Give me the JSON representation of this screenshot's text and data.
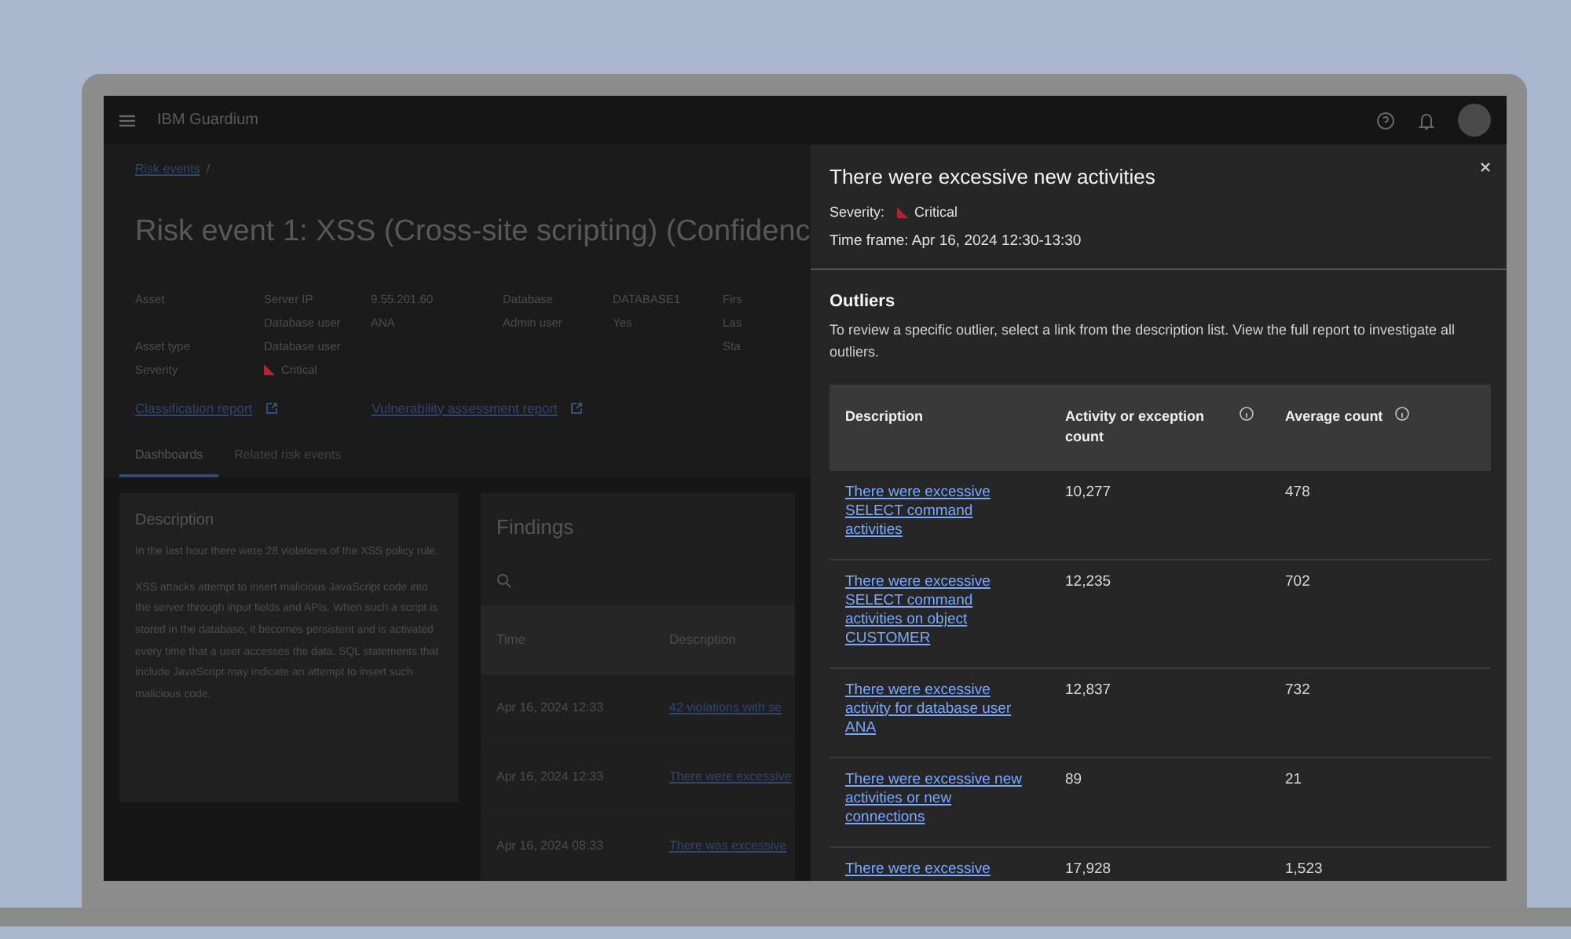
{
  "header": {
    "product": "IBM Guardium"
  },
  "breadcrumb": [
    "Risk events",
    "/"
  ],
  "title": "Risk event 1: XSS (Cross-site scripting)  (Confidenc",
  "details": [
    {
      "label": "Asset",
      "pairs": [
        [
          "Server IP",
          "9.55.201.60"
        ],
        [
          "Database",
          "DATABASE1"
        ]
      ]
    },
    {
      "pairs": [
        [
          "Database user",
          "ANA"
        ],
        [
          "Admin user",
          "Yes"
        ]
      ]
    },
    {
      "label": "Asset type",
      "value": "Database user"
    },
    {
      "label": "Severity",
      "value": "Critical",
      "kind": "severity"
    }
  ],
  "cut_labels": [
    "Firs",
    "Las",
    "Sta"
  ],
  "links": [
    "Classification report",
    "Vulnerability assessment report"
  ],
  "tabs": [
    {
      "label": "Dashboards",
      "selected": true
    },
    {
      "label": "Related risk events",
      "selected": false
    }
  ],
  "description_card": {
    "title": "Description",
    "paragraphs": [
      "In the last hour there were 28 violations of the XSS policy rule.",
      "XSS attacks attempt to insert malicious JavaScript code into the server through input fields and APIs. When such a script is stored in the database, it becomes persistent and is activated every time that a user accesses the data. SQL statements that include JavaScript may indicate an attempt to insert such malicious code."
    ]
  },
  "findings": {
    "title": "Findings",
    "columns": [
      "Time",
      "Description"
    ],
    "rows": [
      [
        "Apr 16, 2024 12:33",
        "42 violations with se"
      ],
      [
        "Apr 16, 2024 12:33",
        "There were excessive"
      ],
      [
        "Apr 16, 2024 08:33",
        "There was excessive"
      ]
    ]
  },
  "panel": {
    "title": "There were excessive new activities",
    "severity_label": "Severity:",
    "severity": "Critical",
    "time_frame": "Time frame: Apr 16, 2024 12:30-13:30",
    "section": "Outliers",
    "intro": "To review a specific outlier, select a link from the description list. View the full report to investigate all outliers.",
    "columns": [
      {
        "label": "Description",
        "info": false
      },
      {
        "label": "Activity or exception count",
        "info": true
      },
      {
        "label": "Average count",
        "info": true
      }
    ],
    "rows": [
      [
        "There were excessive SELECT command activities",
        "10,277",
        "478"
      ],
      [
        "There were excessive SELECT command activities on object CUSTOMER",
        "12,235",
        "702"
      ],
      [
        "There were excessive activity for database user ANA",
        "12,837",
        "732"
      ],
      [
        "There were excessive new activities or new connections",
        "89",
        "21"
      ],
      [
        "There were excessive",
        "17,928",
        "1,523"
      ]
    ]
  }
}
